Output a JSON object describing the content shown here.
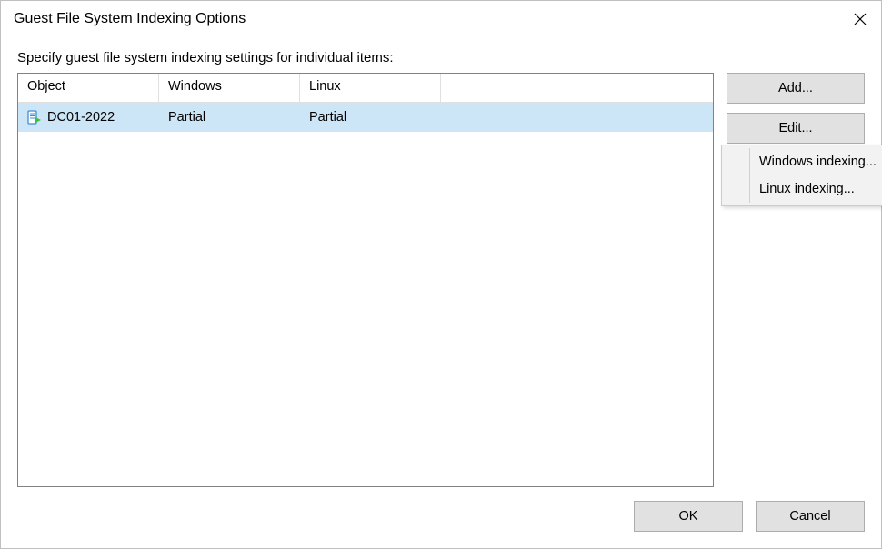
{
  "dialog": {
    "title": "Guest File System Indexing Options",
    "instruction": "Specify guest file system indexing settings for individual items:"
  },
  "table": {
    "headers": {
      "object": "Object",
      "windows": "Windows",
      "linux": "Linux"
    },
    "rows": [
      {
        "object": "DC01-2022",
        "windows": "Partial",
        "linux": "Partial"
      }
    ]
  },
  "buttons": {
    "add": "Add...",
    "edit": "Edit...",
    "ok": "OK",
    "cancel": "Cancel"
  },
  "edit_menu": {
    "windows_indexing": "Windows indexing...",
    "linux_indexing": "Linux indexing..."
  }
}
